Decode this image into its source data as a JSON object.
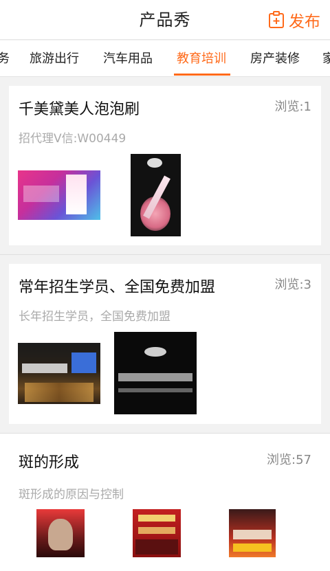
{
  "header": {
    "title": "产品秀",
    "publish_label": "发布"
  },
  "tabs": [
    {
      "label": "务"
    },
    {
      "label": "旅游出行"
    },
    {
      "label": "汽车用品"
    },
    {
      "label": "教育培训",
      "active": true
    },
    {
      "label": "房产装修"
    },
    {
      "label": "家"
    }
  ],
  "cards": [
    {
      "title": "千美黛美人泡泡刷",
      "views": "浏览:1",
      "subtitle": "招代理V信:W00449"
    },
    {
      "title": "常年招生学员、全国免费加盟",
      "views": "浏览:3",
      "subtitle": "长年招生学员，全国免费加盟"
    },
    {
      "title": "斑的形成",
      "views": "浏览:57",
      "subtitle": "斑形成的原因与控制"
    }
  ],
  "colors": {
    "accent": "#ff6a1a",
    "text": "#111111",
    "muted": "#aaaaaa",
    "background": "#f2f2f2"
  }
}
